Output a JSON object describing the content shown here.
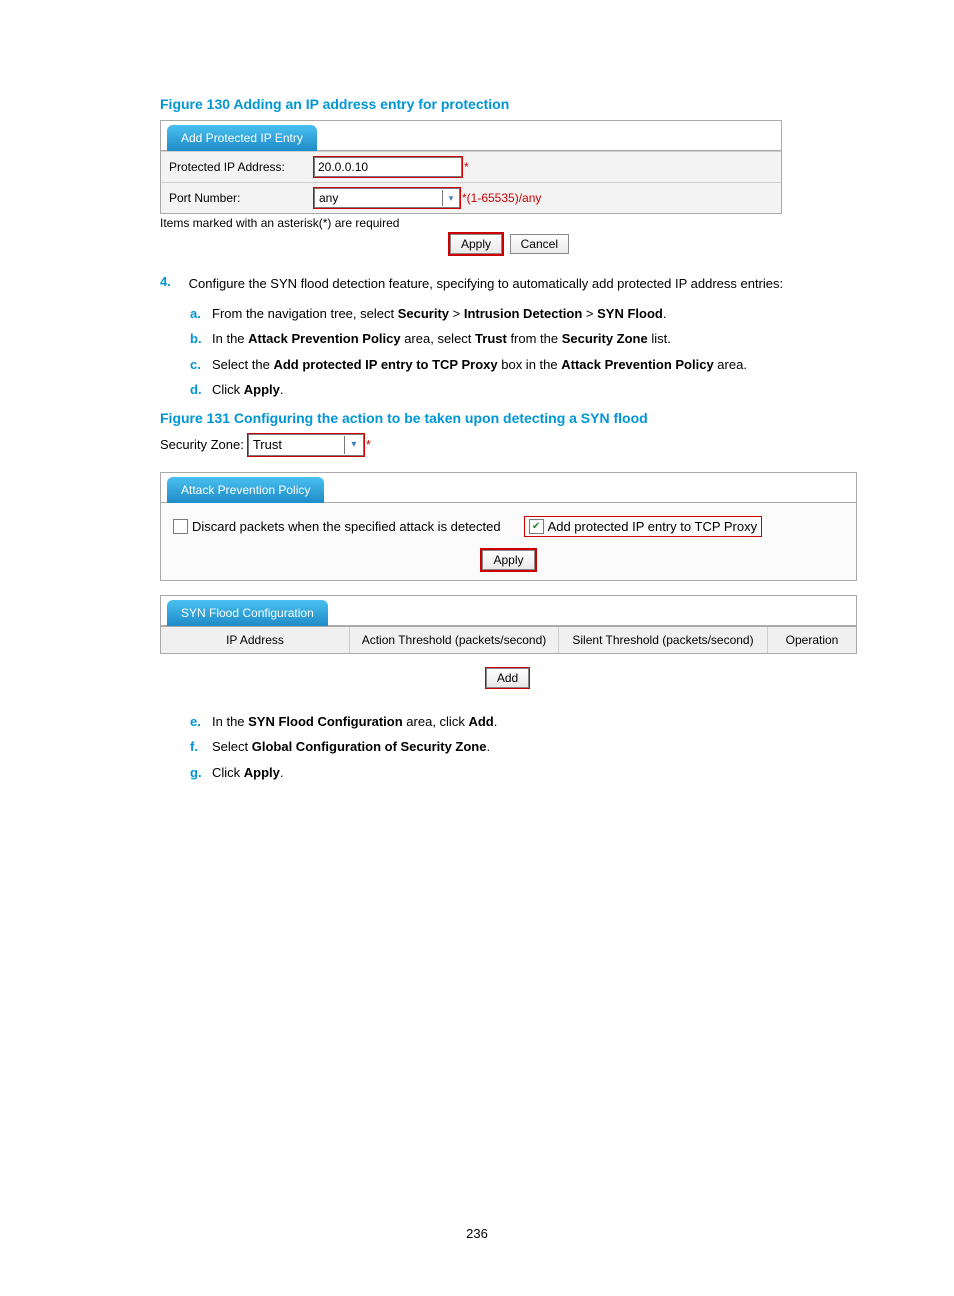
{
  "captions": {
    "fig130": "Figure 130 Adding an IP address entry for protection",
    "fig131": "Figure 131 Configuring the action to be taken upon detecting a SYN flood"
  },
  "fig130": {
    "tab": "Add Protected IP Entry",
    "protected_label": "Protected IP Address:",
    "protected_value": "20.0.0.10",
    "port_label": "Port Number:",
    "port_value": "any",
    "port_hint": "*(1-65535)/any",
    "asterisk": "*",
    "note": "Items marked with an asterisk(*) are required",
    "apply": "Apply",
    "cancel": "Cancel"
  },
  "step4": {
    "num": "4.",
    "text": "Configure the SYN flood detection feature, specifying to automatically add protected IP address entries:",
    "a": {
      "m": "a.",
      "pre": "From the navigation tree, select ",
      "b1": "Security",
      "sep1": " > ",
      "b2": "Intrusion Detection",
      "sep2": " > ",
      "b3": "SYN Flood",
      "post": "."
    },
    "b": {
      "m": "b.",
      "pre": "In the ",
      "b1": "Attack Prevention Policy",
      "mid": " area, select ",
      "b2": "Trust",
      "mid2": " from the ",
      "b3": "Security Zone",
      "post": " list."
    },
    "c": {
      "m": "c.",
      "pre": "Select the ",
      "b1": "Add protected IP entry to TCP Proxy",
      "mid": " box in the ",
      "b2": "Attack Prevention Policy",
      "post": " area."
    },
    "d": {
      "m": "d.",
      "pre": "Click ",
      "b1": "Apply",
      "post": "."
    }
  },
  "fig131": {
    "sz_label": "Security Zone:",
    "sz_value": "Trust",
    "asterisk": "*",
    "tab_policy": "Attack Prevention Policy",
    "cb_discard": "Discard packets when the specified attack is detected",
    "cb_addip": "Add protected IP entry to TCP Proxy",
    "apply": "Apply",
    "tab_synconf": "SYN Flood Configuration",
    "th1": "IP Address",
    "th2": "Action Threshold (packets/second)",
    "th3": "Silent Threshold (packets/second)",
    "th4": "Operation",
    "add": "Add"
  },
  "post_steps": {
    "e": {
      "m": "e.",
      "pre": "In the ",
      "b1": "SYN Flood Configuration",
      "mid": " area, click ",
      "b2": "Add",
      "post": "."
    },
    "f": {
      "m": "f.",
      "pre": "Select ",
      "b1": "Global Configuration of Security Zone",
      "post": "."
    },
    "g": {
      "m": "g.",
      "pre": "Click ",
      "b1": "Apply",
      "post": "."
    }
  },
  "page_number": "236"
}
